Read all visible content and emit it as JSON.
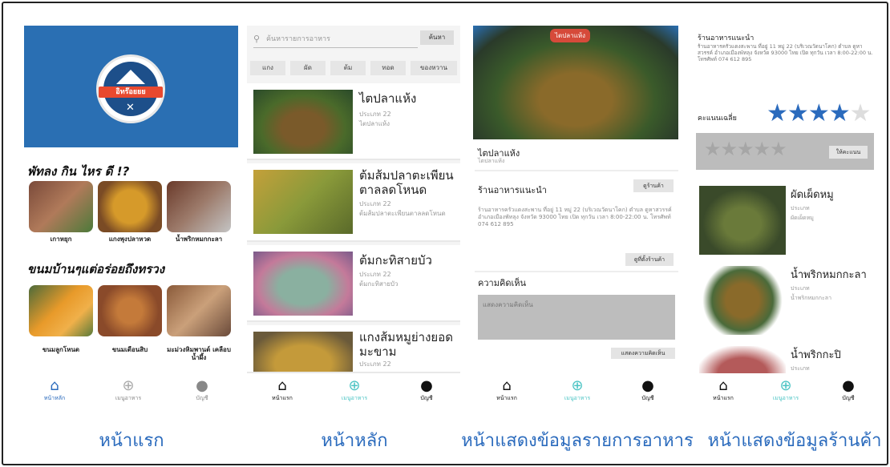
{
  "screens": {
    "home": {
      "banner_text": "อิทร๊อยยย",
      "heading1": "พัทลง กิน ไหร ดี !?",
      "thumbs1": [
        "เกาหยุก",
        "แกงพุงปลาหวด",
        "น้ำพริกหมกกะลา"
      ],
      "heading2": "ขนมบ้านๆแต่อร่อยถึงทรวง",
      "thumbs2": [
        "ขนมลูกโหนด",
        "ขนมเดือนสิบ",
        "มะม่วงหิมพานต์ เคลือบน้ำผึ้ง"
      ],
      "nav": [
        {
          "icon": "⌂",
          "label": "หน้าหลัก"
        },
        {
          "icon": "⊕",
          "label": "เมนูอาหาร"
        },
        {
          "icon": "●",
          "label": "บัญชี"
        }
      ]
    },
    "main": {
      "search_placeholder": "ค้นหารายการอาหาร",
      "search_button": "ค้นหา",
      "chips": [
        "แกง",
        "ผัด",
        "ต้ม",
        "ทอด",
        "ของหวาน"
      ],
      "cards": [
        {
          "title": "ไตปลาแห้ง",
          "price": "ประเภท 22",
          "desc": "ไตปลาแห้ง"
        },
        {
          "title": "ต้มส้มปลาตะเพียนตาลลดโหนด",
          "price": "ประเภท 22",
          "desc": "ต้มส้มปลาตะเพียนตาลลดโหนด"
        },
        {
          "title": "ต้มกะทิสายบัว",
          "price": "ประเภท 22",
          "desc": "ต้มกะทิสายบัว"
        },
        {
          "title": "แกงส้มหมูย่างยอดมะขาม",
          "price": "ประเภท 22",
          "desc": ""
        }
      ],
      "nav": [
        {
          "icon": "⌂",
          "label": "หน้าแรก"
        },
        {
          "icon": "⊕",
          "label": "เมนูอาหาร"
        },
        {
          "icon": "●",
          "label": "บัญชี"
        }
      ]
    },
    "food_detail": {
      "hero_tag": "ไตปลาแห้ง",
      "title": "ไตปลาแห้ง",
      "subtitle": "ไตปลาแห้ง",
      "section_store": "ร้านอาหารแนะนำ",
      "store_button": "ดูร้านค้า",
      "info": "ร้านอาหารครัวแดงสะพาน ที่อยู่ 11 หมู่ 22 (บริเวณวัดนาโคก) ตำบล ดูหาสวรรค์ อำเภอเมืองพัทลุง จังหวัด 93000 ไทย เปิด ทุกวัน เวลา 8:00-22:00 น. โทรศัพท์ 074 612 895",
      "map_button": "ดูที่ตั้งร้านค้า",
      "section_comment": "ความคิดเห็น",
      "comment_placeholder": "แสดงความคิดเห็น",
      "comment_button": "แสดงความคิดเห็น",
      "nav": [
        {
          "icon": "⌂",
          "label": "หน้าแรก"
        },
        {
          "icon": "⊕",
          "label": "เมนูอาหาร"
        },
        {
          "icon": "●",
          "label": "บัญชี"
        }
      ]
    },
    "store_detail": {
      "name": "ร้านอาหารแนะนำ",
      "info": "ร้านอาหารครัวแดงสะพาน ที่อยู่ 11 หมู่ 22 (บริเวณวัดนาโคก) ตำบล ดูหาสวรรค์ อำเภอเมืองพัทลุง จังหวัด 93000 ไทย เปิด ทุกวัน เวลา 8:00-22:00 น. โทรศัพท์ 074 612 895",
      "rating_label": "คะแนนเฉลี่ย",
      "rating": 4,
      "rate_button": "ให้คะแนน",
      "cards": [
        {
          "title": "ผัดเผ็ดหมู",
          "price": "ประเภท",
          "desc": "ผัดเผ็ดหมู"
        },
        {
          "title": "น้ำพริกหมกกะลา",
          "price": "ประเภท",
          "desc": "น้ำพริกหมกกะลา"
        },
        {
          "title": "น้ำพริกกะปิ",
          "price": "ประเภท",
          "desc": ""
        }
      ],
      "nav": [
        {
          "icon": "⌂",
          "label": "หน้าแรก"
        },
        {
          "icon": "⊕",
          "label": "เมนูอาหาร"
        },
        {
          "icon": "●",
          "label": "บัญชี"
        }
      ]
    }
  },
  "captions": [
    "หน้าแรก",
    "หน้าหลัก",
    "หน้าแสดงข้อมูลรายการอาหาร",
    "หน้าแสดงข้อมูลร้านค้า"
  ],
  "colors": {
    "accent": "#2b6bbd",
    "banner": "#2a6fb3"
  }
}
